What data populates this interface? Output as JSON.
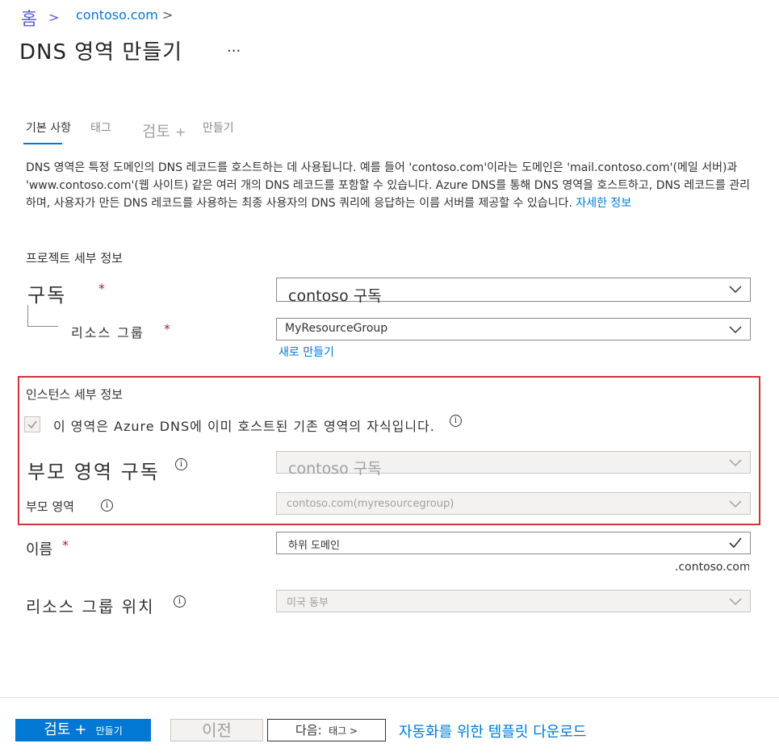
{
  "breadcrumb": {
    "home": "홈",
    "sep": ">",
    "domain": "contoso.com",
    "sep2": ">"
  },
  "page": {
    "title": "DNS 영역 만들기",
    "more": "..."
  },
  "tabs": [
    {
      "label": "기본 사항"
    },
    {
      "label": "태그"
    },
    {
      "label": "검토",
      "plus": "+"
    },
    {
      "label": "만들기"
    }
  ],
  "description": "DNS 영역은 특정 도메인의 DNS 레코드를 호스트하는 데 사용됩니다. 예를 들어 'contoso.com'이라는 도메인은 'mail.contoso.com'(메일 서버)과 'www.contoso.com'(웹 사이트) 같은 여러 개의 DNS 레코드를 포함할 수 있습니다. Azure DNS를 통해 DNS 영역을 호스트하고, DNS 레코드를 관리하며, 사용자가 만든 DNS 레코드를 사용하는 최종 사용자의 DNS 쿼리에 응답하는 이름 서버를 제공할 수 있습니다.",
  "learn_more": "자세한 정보",
  "project": {
    "heading": "프로젝트 세부 정보",
    "subscription_label": "구독",
    "subscription_value": "contoso 구독",
    "rg_label": "리소스 그룹",
    "rg_value": "MyResourceGroup",
    "create_new": "새로 만들기",
    "required": "*"
  },
  "instance": {
    "heading": "인스턴스 세부 정보",
    "child_checkbox_label": "이 영역은 Azure DNS에 이미 호스트된 기존 영역의 자식입니다.",
    "child_checked": true,
    "parent_sub_label": "부모 영역 구독",
    "parent_sub_value": "contoso 구독",
    "parent_zone_label": "부모 영역",
    "parent_zone_value": "contoso.com(myresourcegroup)",
    "info": "i"
  },
  "name": {
    "label": "이름",
    "value": "하위 도메인",
    "suffix": ".contoso.com",
    "valid": true
  },
  "rg_location": {
    "label": "리소스 그룹 위치",
    "value": "미국 동부"
  },
  "footer": {
    "review_label": "검토",
    "review_plus": "+",
    "create_label": "만들기",
    "prev_label": "이전",
    "next_label": "다음:",
    "next_target": "태그 >",
    "download_link": "자동화를 위한 템플릿 다운로드"
  },
  "colors": {
    "accent": "#0078d4",
    "highlight_box": "#d13438",
    "required": "#a4262c"
  }
}
